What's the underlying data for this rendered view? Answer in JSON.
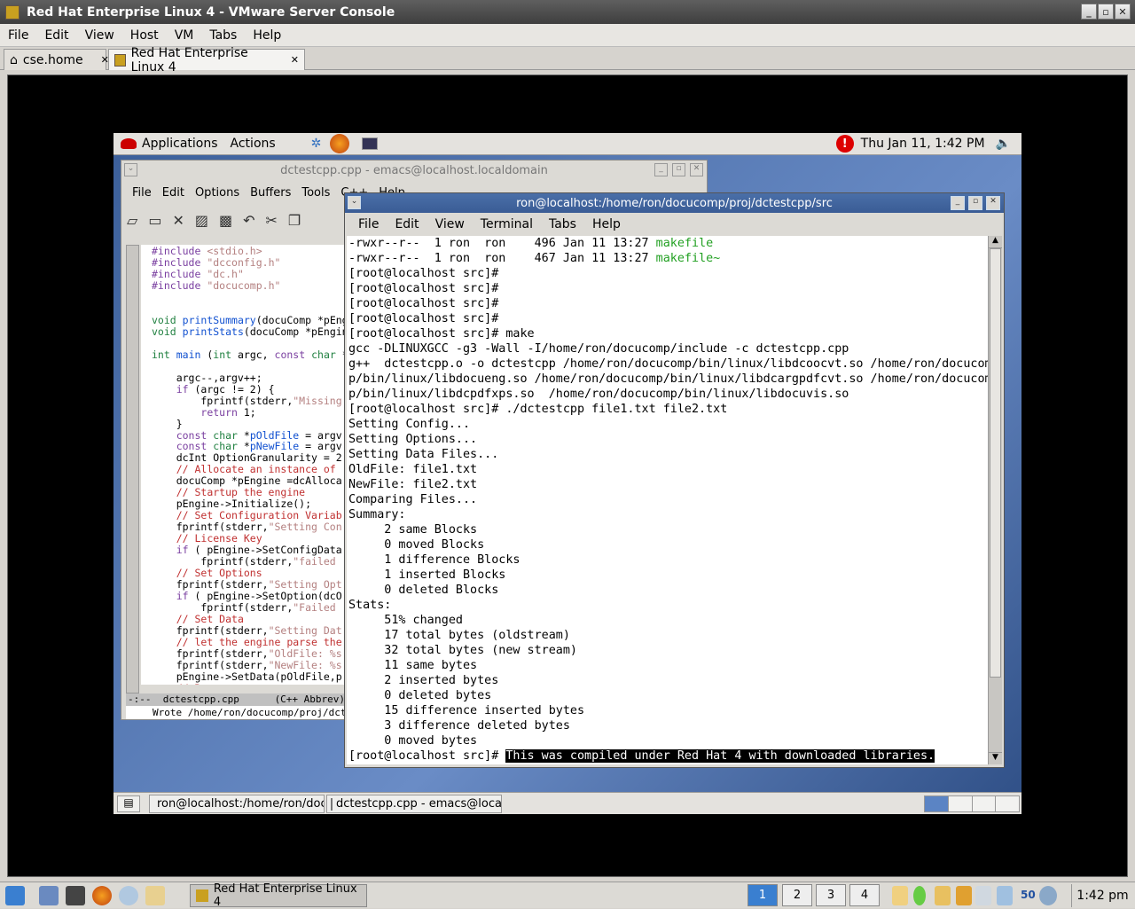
{
  "host": {
    "title": "Red Hat Enterprise Linux 4 - VMware Server Console",
    "menu": [
      "File",
      "Edit",
      "View",
      "Host",
      "VM",
      "Tabs",
      "Help"
    ],
    "tabs": [
      {
        "label": "cse.home",
        "close": "✕"
      },
      {
        "label": "Red Hat Enterprise Linux 4",
        "close": "✕"
      }
    ]
  },
  "guest_panel": {
    "applications": "Applications",
    "actions": "Actions",
    "clock": "Thu Jan 11,  1:42 PM"
  },
  "emacs": {
    "title": "dctestcpp.cpp - emacs@localhost.localdomain",
    "menu": [
      "File",
      "Edit",
      "Options",
      "Buffers",
      "Tools",
      "C++",
      "Help"
    ],
    "modeline": "-:--  dctestcpp.cpp      (C++ Abbrev)",
    "minibuffer": "Wrote /home/ron/docucomp/proj/dctestcpp/src/dctestcpp.cpp"
  },
  "terminal": {
    "title": "ron@localhost:/home/ron/docucomp/proj/dctestcpp/src",
    "menu": [
      "File",
      "Edit",
      "View",
      "Terminal",
      "Tabs",
      "Help"
    ],
    "lines": [
      {
        "pre": "-rwxr--r--  1 ron  ron    496 Jan 11 13:27 ",
        "green": "makefile"
      },
      {
        "pre": "-rwxr--r--  1 ron  ron    467 Jan 11 13:27 ",
        "green": "makefile~"
      },
      {
        "pre": "[root@localhost src]#"
      },
      {
        "pre": "[root@localhost src]#"
      },
      {
        "pre": "[root@localhost src]#"
      },
      {
        "pre": "[root@localhost src]#"
      },
      {
        "pre": "[root@localhost src]# make"
      },
      {
        "pre": "gcc -DLINUXGCC -g3 -Wall -I/home/ron/docucomp/include -c dctestcpp.cpp"
      },
      {
        "pre": "g++  dctestcpp.o -o dctestcpp /home/ron/docucomp/bin/linux/libdcoocvt.so /home/ron/docucom"
      },
      {
        "pre": "p/bin/linux/libdocueng.so /home/ron/docucomp/bin/linux/libdcargpdfcvt.so /home/ron/docucom"
      },
      {
        "pre": "p/bin/linux/libdcpdfxps.so  /home/ron/docucomp/bin/linux/libdocuvis.so"
      },
      {
        "pre": "[root@localhost src]# ./dctestcpp file1.txt file2.txt"
      },
      {
        "pre": "Setting Config..."
      },
      {
        "pre": "Setting Options..."
      },
      {
        "pre": "Setting Data Files..."
      },
      {
        "pre": "OldFile: file1.txt"
      },
      {
        "pre": "NewFile: file2.txt"
      },
      {
        "pre": "Comparing Files..."
      },
      {
        "pre": "Summary:"
      },
      {
        "pre": "     2 same Blocks"
      },
      {
        "pre": "     0 moved Blocks"
      },
      {
        "pre": "     1 difference Blocks"
      },
      {
        "pre": "     1 inserted Blocks"
      },
      {
        "pre": "     0 deleted Blocks"
      },
      {
        "pre": "Stats:"
      },
      {
        "pre": "     51% changed"
      },
      {
        "pre": "     17 total bytes (oldstream)"
      },
      {
        "pre": "     32 total bytes (new stream)"
      },
      {
        "pre": "     11 same bytes"
      },
      {
        "pre": "     2 inserted bytes"
      },
      {
        "pre": "     0 deleted bytes"
      },
      {
        "pre": "     15 difference inserted bytes"
      },
      {
        "pre": "     3 difference deleted bytes"
      },
      {
        "pre": "     0 moved bytes"
      },
      {
        "pre": "[root@localhost src]# ",
        "sel": "This was compiled under Red Hat 4 with downloaded libraries."
      }
    ]
  },
  "guest_taskbar": [
    {
      "label": "ron@localhost:/home/ron/docu"
    },
    {
      "label": "dctestcpp.cpp - emacs@local"
    }
  ],
  "kde_panel": {
    "task": "Red Hat Enterprise Linux 4",
    "desktops": [
      "1",
      "2",
      "3",
      "4"
    ],
    "clock": "1:42 pm",
    "tray_number": "50"
  }
}
